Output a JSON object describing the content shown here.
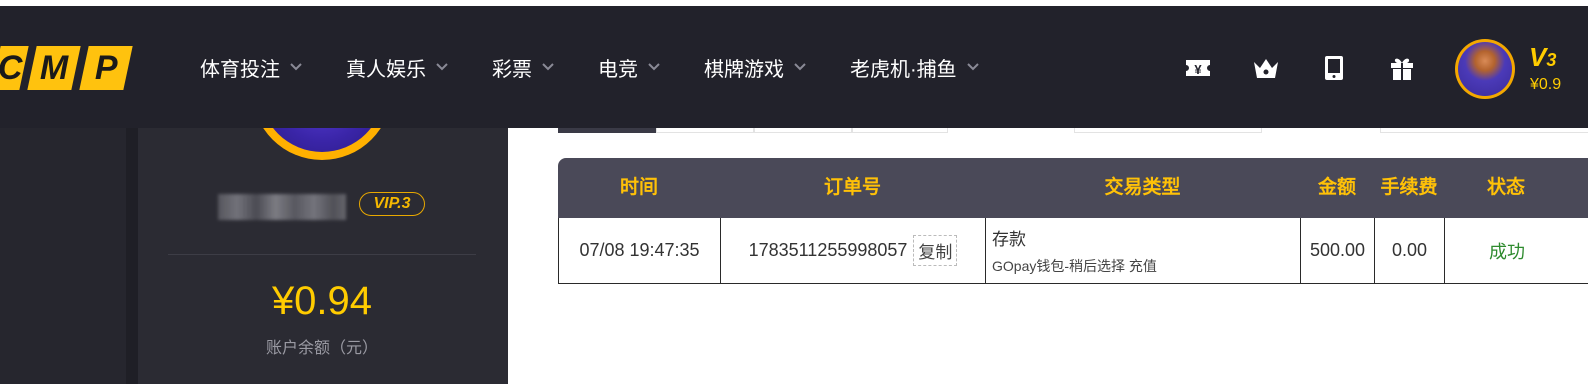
{
  "logo": {
    "letters": [
      "C",
      "M",
      "P"
    ]
  },
  "nav": {
    "items": [
      {
        "label": "体育投注"
      },
      {
        "label": "真人娱乐"
      },
      {
        "label": "彩票"
      },
      {
        "label": "电竞"
      },
      {
        "label": "棋牌游戏"
      },
      {
        "label": "老虎机·捕鱼"
      }
    ]
  },
  "header": {
    "icons": [
      "ticket-icon",
      "crown-icon",
      "tablet-icon",
      "gift-icon"
    ],
    "vip_level": "V",
    "vip_num": "3",
    "balance": "¥0.9"
  },
  "profile": {
    "vip_badge": "VIP.3",
    "balance": "¥0.94",
    "balance_label": "账户余额（元）"
  },
  "table": {
    "headers": [
      "时间",
      "订单号",
      "交易类型",
      "金额",
      "手续费",
      "状态"
    ],
    "rows": [
      {
        "time": "07/08 19:47:35",
        "order_no": "1783511255998057",
        "copy_label": "复制",
        "type_main": "存款",
        "type_sub": "GOpay钱包-稍后选择 充值",
        "amount": "500.00",
        "fee": "0.00",
        "status": "成功"
      }
    ]
  },
  "colors": {
    "header_bg": "#22222b",
    "accent": "#ffc107",
    "success": "#2e8b2e",
    "table_head": "#4a4958"
  }
}
